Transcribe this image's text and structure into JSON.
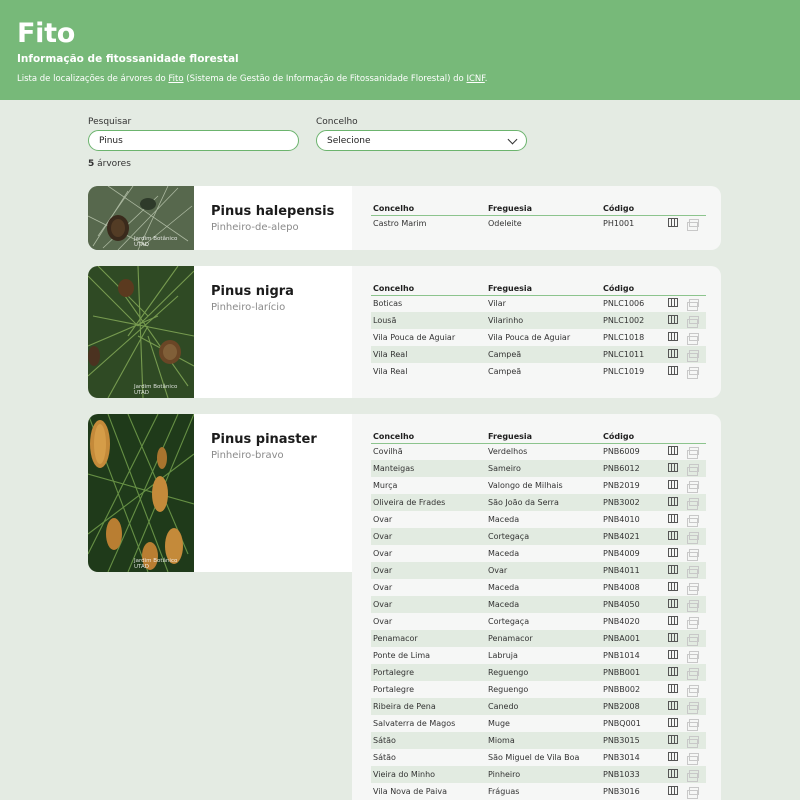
{
  "header": {
    "title": "Fito",
    "subtitle": "Informação de fitossanidade florestal",
    "desc_prefix": "Lista de localizações de árvores do ",
    "desc_link1": "Fito",
    "desc_middle": " (Sistema de Gestão de Informação de Fitossanidade Florestal) do ",
    "desc_link2": "ICNF",
    "desc_suffix": "."
  },
  "search": {
    "label": "Pesquisar",
    "value": "Pinus"
  },
  "concelho": {
    "label": "Concelho",
    "selected": "Selecione"
  },
  "count": {
    "number": "5",
    "label": " árvores"
  },
  "columns": {
    "concelho": "Concelho",
    "freguesia": "Freguesia",
    "codigo": "Código"
  },
  "species": [
    {
      "scientific": "Pinus halepensis",
      "common": "Pinheiro-de-alepo",
      "credit": "Jardim Botânico UTAD",
      "rows": [
        [
          "Castro Marim",
          "Odeleite",
          "PH1001"
        ]
      ]
    },
    {
      "scientific": "Pinus nigra",
      "common": "Pinheiro-larício",
      "credit": "Jardim Botânico UTAD",
      "rows": [
        [
          "Boticas",
          "Vilar",
          "PNLC1006"
        ],
        [
          "Lousã",
          "Vilarinho",
          "PNLC1002"
        ],
        [
          "Vila Pouca de Aguiar",
          "Vila Pouca de Aguiar",
          "PNLC1018"
        ],
        [
          "Vila Real",
          "Campeã",
          "PNLC1011"
        ],
        [
          "Vila Real",
          "Campeã",
          "PNLC1019"
        ]
      ]
    },
    {
      "scientific": "Pinus pinaster",
      "common": "Pinheiro-bravo",
      "credit": "Jardim Botânico UTAD",
      "rows": [
        [
          "Covilhã",
          "Verdelhos",
          "PNB6009"
        ],
        [
          "Manteigas",
          "Sameiro",
          "PNB6012"
        ],
        [
          "Murça",
          "Valongo de Milhais",
          "PNB2019"
        ],
        [
          "Oliveira de Frades",
          "São João da Serra",
          "PNB3002"
        ],
        [
          "Ovar",
          "Maceda",
          "PNB4010"
        ],
        [
          "Ovar",
          "Cortegaça",
          "PNB4021"
        ],
        [
          "Ovar",
          "Maceda",
          "PNB4009"
        ],
        [
          "Ovar",
          "Ovar",
          "PNB4011"
        ],
        [
          "Ovar",
          "Maceda",
          "PNB4008"
        ],
        [
          "Ovar",
          "Maceda",
          "PNB4050"
        ],
        [
          "Ovar",
          "Cortegaça",
          "PNB4020"
        ],
        [
          "Penamacor",
          "Penamacor",
          "PNBA001"
        ],
        [
          "Ponte de Lima",
          "Labruja",
          "PNB1014"
        ],
        [
          "Portalegre",
          "Reguengo",
          "PNBB001"
        ],
        [
          "Portalegre",
          "Reguengo",
          "PNBB002"
        ],
        [
          "Ribeira de Pena",
          "Canedo",
          "PNB2008"
        ],
        [
          "Salvaterra de Magos",
          "Muge",
          "PNBQ001"
        ],
        [
          "Sátão",
          "Mioma",
          "PNB3015"
        ],
        [
          "Sátão",
          "São Miguel de Vila Boa",
          "PNB3014"
        ],
        [
          "Vieira do Minho",
          "Pinheiro",
          "PNB1033"
        ],
        [
          "Vila Nova de Paiva",
          "Fráguas",
          "PNB3016"
        ]
      ]
    }
  ],
  "icons": {
    "map": "map-icon",
    "copy": "copy-icon"
  }
}
